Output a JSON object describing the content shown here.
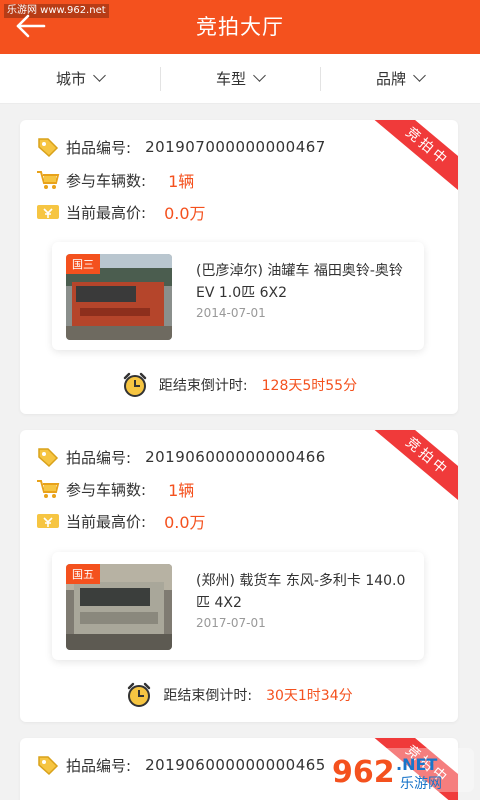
{
  "watermark": "乐游网 www.962.net",
  "header": {
    "title": "竞拍大厅"
  },
  "filters": [
    {
      "label": "城市"
    },
    {
      "label": "车型"
    },
    {
      "label": "品牌"
    }
  ],
  "labels": {
    "lot_no": "拍品编号:",
    "vehicle_count": "参与车辆数:",
    "highest_price": "当前最高价:",
    "countdown": "距结束倒计时:",
    "ribbon": "竞拍中"
  },
  "icons": [
    "tag-icon",
    "cart-icon",
    "ticket-icon",
    "alarm-clock-icon",
    "back-arrow-icon",
    "chevron-down-icon"
  ],
  "colors": {
    "brand": "#f4511e",
    "ribbon": "#f03a3a",
    "background": "#f2f2f2"
  },
  "auctions": [
    {
      "lot_no": "201907000000000467",
      "vehicle_count": "1辆",
      "highest_price": "0.0万",
      "emission_tag": "国三",
      "vehicle_name": "(巴彦淖尔) 油罐车 福田奥铃-奥铃EV 1.0匹 6X2",
      "date": "2014-07-01",
      "countdown": "128天5时55分"
    },
    {
      "lot_no": "201906000000000466",
      "vehicle_count": "1辆",
      "highest_price": "0.0万",
      "emission_tag": "国五",
      "vehicle_name": "(郑州) 载货车 东风-多利卡 140.0匹 4X2",
      "date": "2017-07-01",
      "countdown": "30天1时34分"
    },
    {
      "lot_no": "201906000000000465"
    }
  ],
  "footer_watermark": {
    "brand": "962",
    "suffix": ".NET",
    "cn": "乐游网"
  }
}
